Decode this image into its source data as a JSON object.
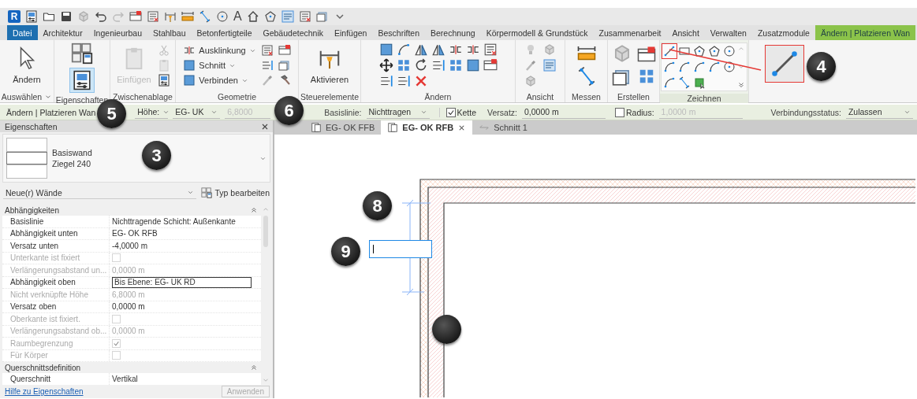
{
  "quick_access": {
    "logo": "R",
    "text_tool": "A"
  },
  "ribbon_tabs": [
    {
      "label": "Datei",
      "kind": "file",
      "selected": false
    },
    {
      "label": "Architektur",
      "kind": "normal",
      "selected": false
    },
    {
      "label": "Ingenieurbau",
      "kind": "normal",
      "selected": false
    },
    {
      "label": "Stahlbau",
      "kind": "normal",
      "selected": false
    },
    {
      "label": "Betonfertigteile",
      "kind": "normal",
      "selected": false
    },
    {
      "label": "Gebäudetechnik",
      "kind": "normal",
      "selected": false
    },
    {
      "label": "Einfügen",
      "kind": "normal",
      "selected": false
    },
    {
      "label": "Beschriften",
      "kind": "normal",
      "selected": false
    },
    {
      "label": "Berechnung",
      "kind": "normal",
      "selected": false
    },
    {
      "label": "Körpermodell & Grundstück",
      "kind": "normal",
      "selected": false
    },
    {
      "label": "Zusammenarbeit",
      "kind": "normal",
      "selected": false
    },
    {
      "label": "Ansicht",
      "kind": "normal",
      "selected": false
    },
    {
      "label": "Verwalten",
      "kind": "normal",
      "selected": false
    },
    {
      "label": "Zusatzmodule",
      "kind": "normal",
      "selected": false
    },
    {
      "label": "Ändern | Platzieren Wan",
      "kind": "contextual",
      "selected": true
    }
  ],
  "ribbon_panels": [
    {
      "title": "Auswählen",
      "menu": true,
      "large": [
        {
          "label": "Ändern",
          "disabled": false
        }
      ]
    },
    {
      "title": "Eigenschaften",
      "menu": false,
      "toggle": {
        "on": true
      }
    },
    {
      "title": "Zwischenablage",
      "menu": false,
      "large": [
        {
          "label": "Einfügen",
          "disabled": true
        }
      ]
    },
    {
      "title": "Geometrie",
      "menu": false,
      "small": [
        {
          "label": "Ausklinkung"
        },
        {
          "label": "Schnitt"
        },
        {
          "label": "Verbinden"
        }
      ]
    },
    {
      "title": "Steuerelemente",
      "menu": false,
      "large": [
        {
          "label": "Aktivieren",
          "disabled": false
        }
      ]
    },
    {
      "title": "Ändern",
      "menu": false
    },
    {
      "title": "Ansicht",
      "menu": false
    },
    {
      "title": "Messen",
      "menu": false
    },
    {
      "title": "Erstellen",
      "menu": false
    },
    {
      "title": "Zeichnen",
      "menu": false
    }
  ],
  "options_bar": {
    "context": "Ändern | Platzieren Wan",
    "items": [
      {
        "kind": "select",
        "value": "Höhe:",
        "disabled": false
      },
      {
        "kind": "select",
        "value": "EG- UK",
        "disabled": false
      },
      {
        "kind": "input",
        "value": "6,8000",
        "disabled": true
      },
      {
        "kind": "label",
        "value": "Basislinie:"
      },
      {
        "kind": "select",
        "value": "Nichttragen",
        "disabled": false
      },
      {
        "kind": "check",
        "value": "Kette",
        "checked": true
      },
      {
        "kind": "label",
        "value": "Versatz:"
      },
      {
        "kind": "input",
        "value": "0,0000 m",
        "disabled": false
      },
      {
        "kind": "check",
        "value": "Radius:",
        "checked": false
      },
      {
        "kind": "input",
        "value": "1,0000 m",
        "disabled": true
      },
      {
        "kind": "label",
        "value": "Verbindungsstatus:"
      },
      {
        "kind": "select",
        "value": "Zulassen",
        "disabled": false
      }
    ]
  },
  "properties": {
    "title": "Eigenschaften",
    "type_family": "Basiswand",
    "type_name": "Ziegel 240",
    "instance_filter": "Neue(r) Wände",
    "edit_type": "Typ bearbeiten",
    "groups": [
      {
        "name": "Abhängigkeiten",
        "expanded": true,
        "rows": [
          {
            "name": "Basislinie",
            "kind": "text",
            "value": "Nichttragende Schicht: Außenkante",
            "disabled": false
          },
          {
            "name": "Abhängigkeit unten",
            "kind": "text",
            "value": "EG- OK RFB",
            "disabled": false
          },
          {
            "name": "Versatz unten",
            "kind": "text",
            "value": "-4,0000 m",
            "disabled": false
          },
          {
            "name": "Unterkante ist fixiert",
            "kind": "check",
            "checked": false,
            "disabled": true
          },
          {
            "name": "Verlängerungsabstand un...",
            "kind": "text",
            "value": "0,0000 m",
            "disabled": true
          },
          {
            "name": "Abhängigkeit oben",
            "kind": "edit",
            "value": "Bis Ebene: EG- UK RD",
            "disabled": false
          },
          {
            "name": "Nicht verknüpfte Höhe",
            "kind": "text",
            "value": "6,8000 m",
            "disabled": true
          },
          {
            "name": "Versatz oben",
            "kind": "text",
            "value": "0,0000 m",
            "disabled": false
          },
          {
            "name": "Oberkante ist fixiert.",
            "kind": "check",
            "checked": false,
            "disabled": true
          },
          {
            "name": "Verlängerungsabstand ob...",
            "kind": "text",
            "value": "0,0000 m",
            "disabled": true
          },
          {
            "name": "Raumbegrenzung",
            "kind": "check",
            "checked": true,
            "disabled": true
          },
          {
            "name": "Für Körper",
            "kind": "check",
            "checked": false,
            "disabled": true
          }
        ]
      },
      {
        "name": "Querschnittsdefinition",
        "expanded": true,
        "rows": [
          {
            "name": "Querschnitt",
            "kind": "text",
            "value": "Vertikal",
            "disabled": false
          }
        ]
      }
    ],
    "help_link": "Hilfe zu Eigenschaften",
    "apply": {
      "label": "Anwenden",
      "disabled": true
    }
  },
  "view_tabs": [
    {
      "label": "EG- OK FFB",
      "kind": "plan",
      "selected": false
    },
    {
      "label": "EG- OK RFB",
      "kind": "plan",
      "selected": true
    },
    {
      "label": "Schnitt 1",
      "kind": "section",
      "selected": false
    }
  ],
  "callouts": [
    {
      "label": "5"
    },
    {
      "label": "6"
    },
    {
      "label": "4"
    },
    {
      "label": "3"
    },
    {
      "label": "8"
    },
    {
      "label": "9"
    }
  ]
}
